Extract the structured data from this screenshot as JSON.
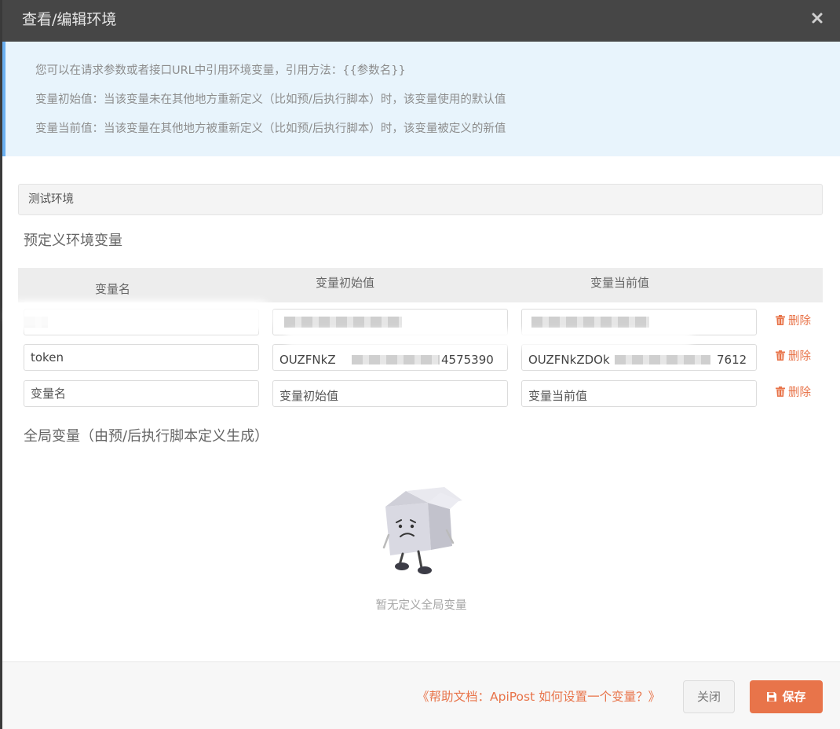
{
  "dialog": {
    "title": "查看/编辑环境"
  },
  "info": {
    "lines": [
      "您可以在请求参数或者接口URL中引用环境变量，引用方法：{{参数名}}",
      "变量初始值：当该变量未在其他地方重新定义（比如预/后执行脚本）时，该变量使用的默认值",
      "变量当前值：当该变量在其他地方被重新定义（比如预/后执行脚本）时，该变量被定义的新值"
    ]
  },
  "environment": {
    "name": "测试环境"
  },
  "predefined": {
    "title": "预定义环境变量",
    "columns": [
      "变量名",
      "变量初始值",
      "变量当前值"
    ],
    "rows": [
      {
        "name": "",
        "initial": "",
        "current": "",
        "delete_label": "删除"
      },
      {
        "name": "token",
        "initial": "OUZFNkZ",
        "initial_tail": "4575390",
        "current": "OUZFNkZDOk",
        "current_tail": "7612",
        "delete_label": "删除"
      }
    ],
    "new_row": {
      "name_placeholder": "变量名",
      "initial_placeholder": "变量初始值",
      "current_placeholder": "变量当前值",
      "delete_label": "删除"
    }
  },
  "global": {
    "title": "全局变量（由预/后执行脚本定义生成）",
    "empty_text": "暂无定义全局变量"
  },
  "footer": {
    "help_link": "《帮助文档：ApiPost 如何设置一个变量？》",
    "close_label": "关闭",
    "save_label": "保存"
  },
  "colors": {
    "accent": "#e8744a",
    "header_bg": "#464646",
    "info_bg": "#e8f4fc",
    "info_border": "#6aaff0"
  },
  "icons": {
    "close": "close-icon",
    "delete": "trash-icon",
    "save": "floppy-disk-icon",
    "empty": "sad-box-illustration"
  }
}
